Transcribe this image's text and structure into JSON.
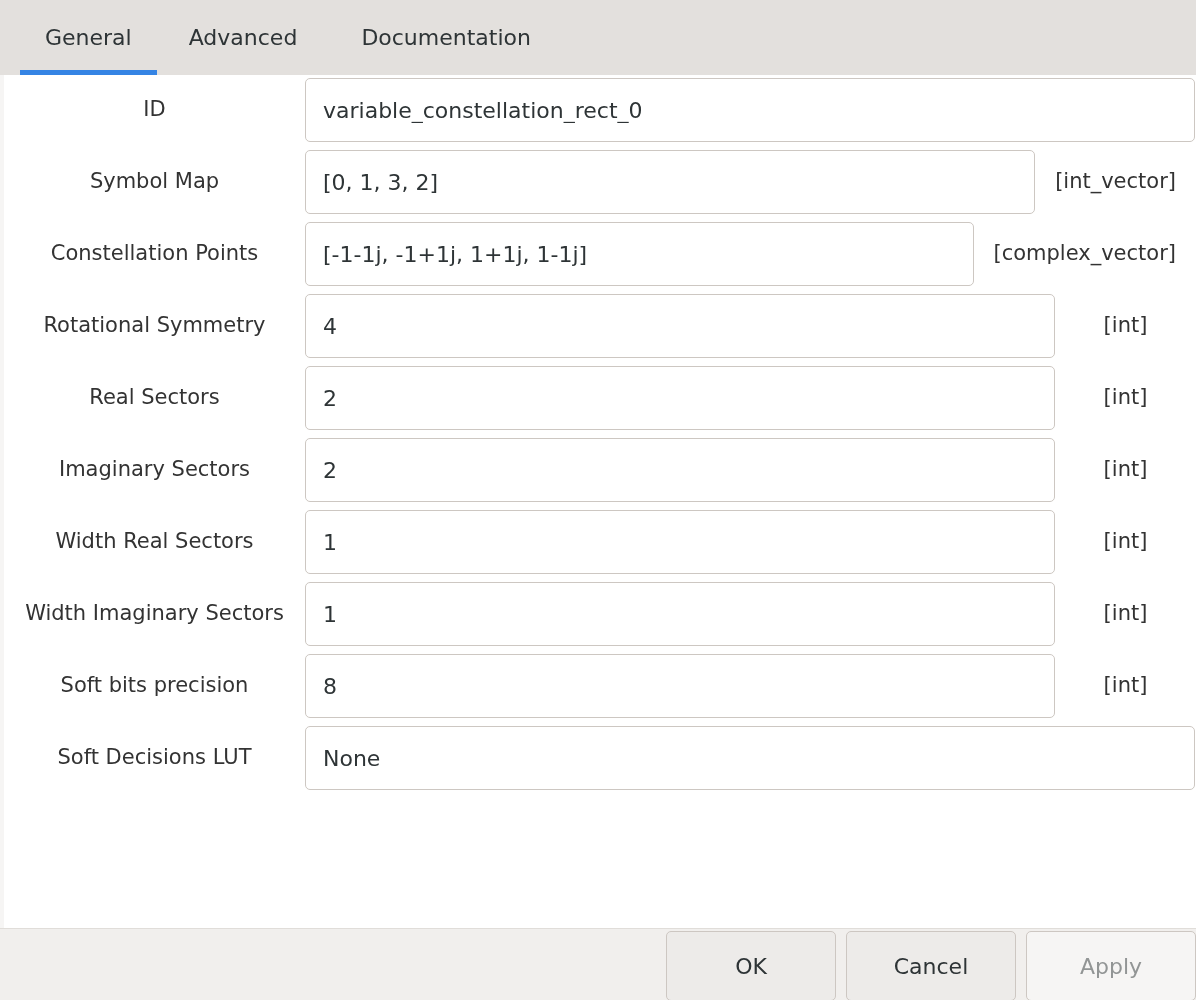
{
  "tabs": [
    {
      "label": "General",
      "selected": true
    },
    {
      "label": "Advanced",
      "selected": false
    },
    {
      "label": "Documentation",
      "selected": false
    }
  ],
  "fields": [
    {
      "label": "ID",
      "value": "variable_constellation_rect_0"
    },
    {
      "label": "Symbol Map",
      "value": "[0, 1, 3, 2]",
      "type": "[int_vector]"
    },
    {
      "label": "Constellation Points",
      "value": "[-1-1j, -1+1j, 1+1j, 1-1j]",
      "type": "[complex_vector]"
    },
    {
      "label": "Rotational Symmetry",
      "value": "4",
      "type": "[int]"
    },
    {
      "label": "Real Sectors",
      "value": "2",
      "type": "[int]"
    },
    {
      "label": "Imaginary Sectors",
      "value": "2",
      "type": "[int]"
    },
    {
      "label": "Width Real Sectors",
      "value": "1",
      "type": "[int]"
    },
    {
      "label": "Width Imaginary Sectors",
      "value": "1",
      "type": "[int]"
    },
    {
      "label": "Soft bits precision",
      "value": "8",
      "type": "[int]"
    },
    {
      "label": "Soft Decisions LUT",
      "value": "None"
    }
  ],
  "buttons": [
    {
      "label": "OK",
      "disabled": false
    },
    {
      "label": "Cancel",
      "disabled": false
    },
    {
      "label": "Apply",
      "disabled": true
    }
  ]
}
